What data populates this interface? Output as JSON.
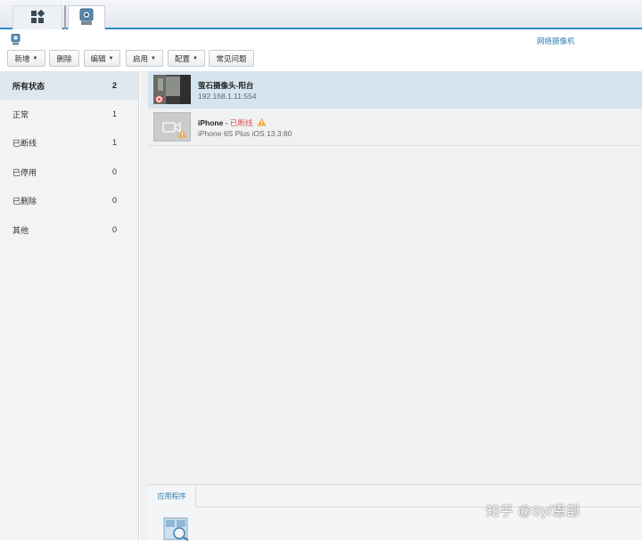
{
  "taskbar": {
    "icons": [
      "apps-grid-icon",
      "camera-app-icon"
    ]
  },
  "window": {
    "title": "网络摄像机"
  },
  "toolbar": {
    "add": "新增",
    "delete": "删除",
    "edit": "编辑",
    "enable": "启用",
    "config": "配置",
    "faq": "常见问题"
  },
  "sidebar": {
    "items": [
      {
        "label": "所有状态",
        "count": "2"
      },
      {
        "label": "正常",
        "count": "1"
      },
      {
        "label": "已断线",
        "count": "1"
      },
      {
        "label": "已停用",
        "count": "0"
      },
      {
        "label": "已删除",
        "count": "0"
      },
      {
        "label": "其他",
        "count": "0"
      }
    ]
  },
  "cameras": [
    {
      "name": "萤石摄像头-阳台",
      "address": "192.168.1.11:554"
    },
    {
      "name": "iPhone",
      "separator": " - ",
      "status": "已断线",
      "address": "iPhone 6S Plus iOS 13.3:80"
    }
  ],
  "bottom_panel": {
    "tab": "应用程序"
  },
  "watermark": "知乎 @Sy/恩部",
  "colors": {
    "accent": "#2c7fb8",
    "selected_row": "#d5e5ef",
    "offline": "#d9534f",
    "warning": "#f0ad4e"
  }
}
